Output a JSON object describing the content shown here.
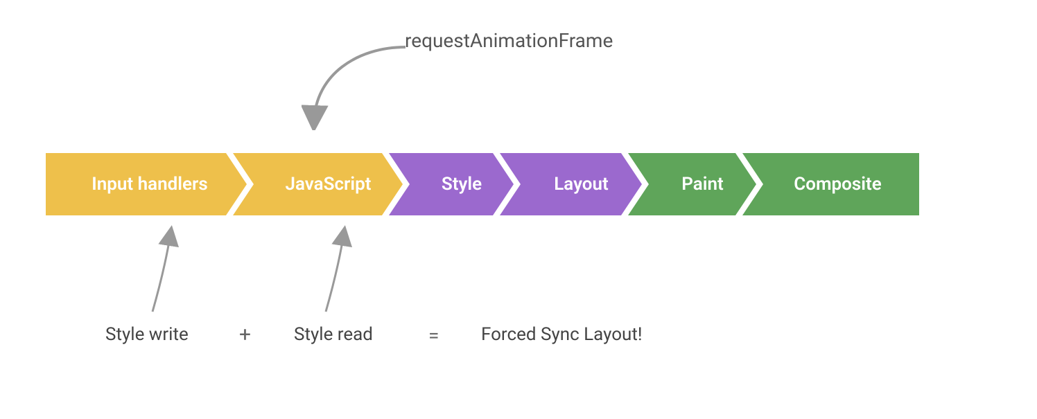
{
  "top_label": "requestAnimationFrame",
  "pipeline": {
    "input_handlers": "Input handlers",
    "javascript": "JavaScript",
    "style": "Style",
    "layout": "Layout",
    "paint": "Paint",
    "composite": "Composite"
  },
  "bottom": {
    "style_write": "Style write",
    "plus": "+",
    "style_read": "Style read",
    "eq": "=",
    "forced_sync_layout": "Forced Sync Layout!"
  },
  "colors": {
    "yellow": "#EEC04B",
    "purple": "#9B69CE",
    "green": "#5FA55A",
    "arrow": "#999999"
  }
}
